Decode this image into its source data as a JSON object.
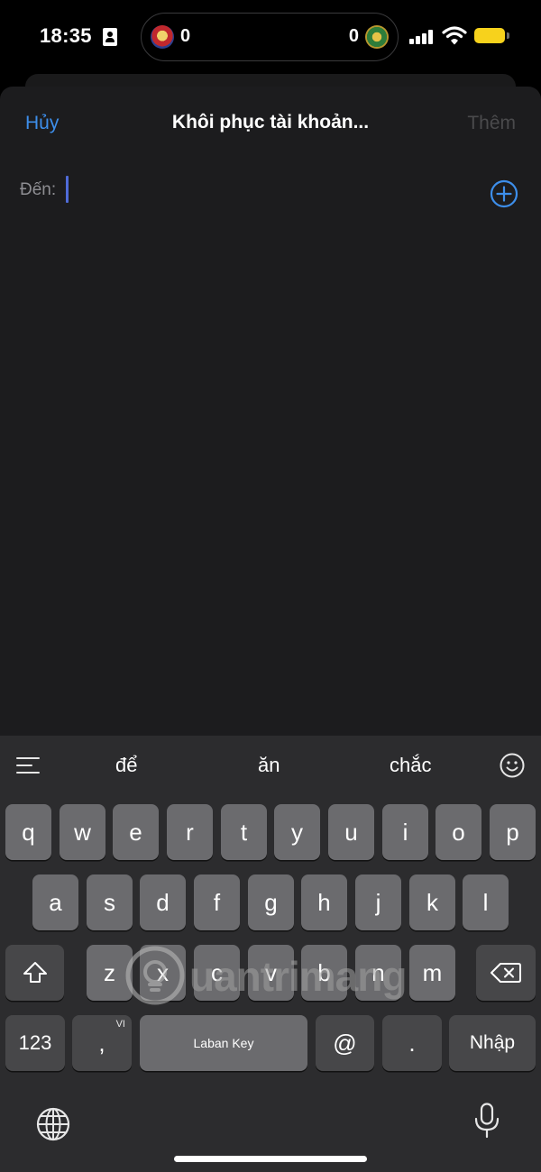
{
  "status_bar": {
    "time": "18:35",
    "live_activity": {
      "score_left": "0",
      "score_right": "0"
    },
    "battery_color": "#f7d21c",
    "icons": [
      "contact-card-icon",
      "team-logo-icon",
      "signal-icon",
      "wifi-icon",
      "battery-icon"
    ]
  },
  "nav": {
    "cancel_label": "Hủy",
    "title": "Khôi phục tài khoản...",
    "add_label": "Thêm"
  },
  "recipient": {
    "to_label": "Đến:",
    "value": ""
  },
  "keyboard": {
    "suggestions": [
      "để",
      "ăn",
      "chắc"
    ],
    "rows": [
      [
        "q",
        "w",
        "e",
        "r",
        "t",
        "y",
        "u",
        "i",
        "o",
        "p"
      ],
      [
        "a",
        "s",
        "d",
        "f",
        "g",
        "h",
        "j",
        "k",
        "l"
      ],
      [
        "z",
        "x",
        "c",
        "v",
        "b",
        "n",
        "m"
      ]
    ],
    "numbers_key": "123",
    "comma_key": ",",
    "comma_sub": "VI",
    "space_key": "Laban Key",
    "at_key": "@",
    "period_key": ".",
    "return_key": "Nhập"
  },
  "watermark": "uantrimang",
  "colors": {
    "accent": "#3d8eea",
    "sheet_bg": "#1c1c1e",
    "keyboard_bg": "#2c2c2e",
    "key_bg": "#6b6b6e"
  }
}
